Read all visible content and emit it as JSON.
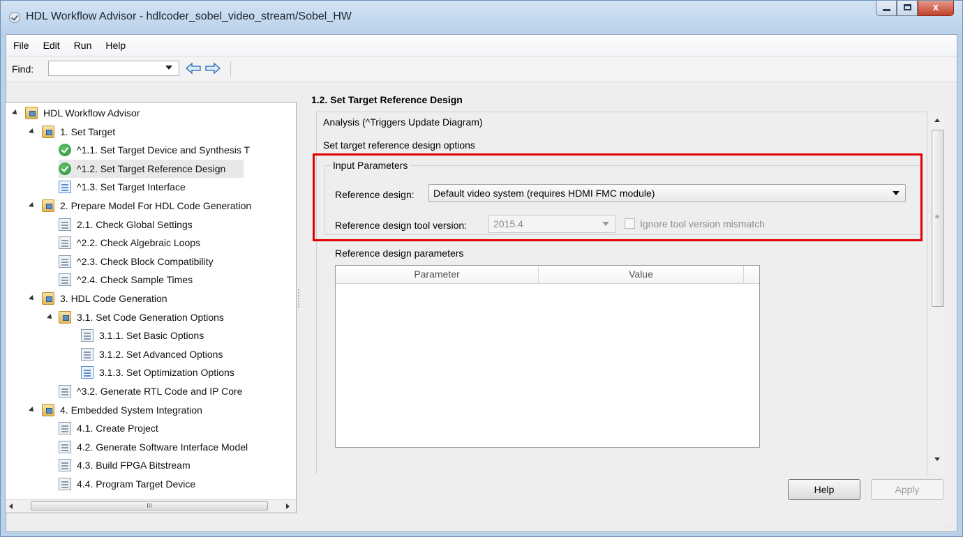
{
  "window": {
    "title": "HDL Workflow Advisor - hdlcoder_sobel_video_stream/Sobel_HW",
    "close_glyph": "x"
  },
  "menu": [
    "File",
    "Edit",
    "Run",
    "Help"
  ],
  "toolbar": {
    "find_label": "Find:",
    "find_value": ""
  },
  "tree": {
    "items": [
      {
        "label": "HDL Workflow Advisor",
        "icon": "folder-icon",
        "level": 0,
        "expanded": true
      },
      {
        "label": "1. Set Target",
        "icon": "folder-icon",
        "level": 1,
        "expanded": true
      },
      {
        "label": "^1.1. Set Target Device and Synthesis T",
        "icon": "check-pass-icon",
        "level": 2
      },
      {
        "label": "^1.2. Set Target Reference Design",
        "icon": "check-pass-icon",
        "level": 2,
        "selected": true
      },
      {
        "label": "^1.3. Set Target Interface",
        "icon": "task-icon",
        "level": 2
      },
      {
        "label": "2. Prepare Model For HDL Code Generation",
        "icon": "folder-icon",
        "level": 1,
        "expanded": true
      },
      {
        "label": "2.1. Check Global Settings",
        "icon": "task-icon",
        "level": 2
      },
      {
        "label": "^2.2. Check Algebraic Loops",
        "icon": "task-icon",
        "level": 2
      },
      {
        "label": "^2.3. Check Block Compatibility",
        "icon": "task-icon",
        "level": 2
      },
      {
        "label": "^2.4. Check Sample Times",
        "icon": "task-icon",
        "level": 2
      },
      {
        "label": "3. HDL Code Generation",
        "icon": "folder-icon",
        "level": 1,
        "expanded": true
      },
      {
        "label": "3.1. Set Code Generation Options",
        "icon": "folder-icon",
        "level": 2,
        "expanded": true
      },
      {
        "label": "3.1.1. Set Basic Options",
        "icon": "task-icon",
        "level": 3
      },
      {
        "label": "3.1.2. Set Advanced Options",
        "icon": "task-icon",
        "level": 3
      },
      {
        "label": "3.1.3. Set Optimization Options",
        "icon": "task-icon",
        "level": 3
      },
      {
        "label": "^3.2. Generate RTL Code and IP Core",
        "icon": "task-icon",
        "level": 2
      },
      {
        "label": "4. Embedded System Integration",
        "icon": "folder-icon",
        "level": 1,
        "expanded": true
      },
      {
        "label": "4.1. Create Project",
        "icon": "task-icon",
        "level": 2
      },
      {
        "label": "4.2. Generate Software Interface Model",
        "icon": "task-icon",
        "level": 2
      },
      {
        "label": "4.3. Build FPGA Bitstream",
        "icon": "task-icon",
        "level": 2
      },
      {
        "label": "4.4. Program Target Device",
        "icon": "task-icon",
        "level": 2
      }
    ],
    "hscroll_grip": "III"
  },
  "panel": {
    "title": "1.2. Set Target Reference Design",
    "analysis_label": "Analysis (^Triggers Update Diagram)",
    "subtitle": "Set target reference design options",
    "input_params_label": "Input Parameters",
    "reference_design_label": "Reference design:",
    "reference_design_value": "Default video system (requires HDMI FMC module)",
    "tool_version_label": "Reference design tool version:",
    "tool_version_value": "2015.4",
    "ignore_mismatch_label": "Ignore tool version mismatch",
    "ignore_mismatch_checked": false,
    "rd_params_label": "Reference design parameters",
    "table_columns": [
      "Parameter",
      "Value"
    ],
    "table_rows": []
  },
  "buttons": {
    "help": "Help",
    "apply": "Apply"
  },
  "colors": {
    "highlight_box": "#e00000",
    "title_bar": "#b9d1ea"
  }
}
